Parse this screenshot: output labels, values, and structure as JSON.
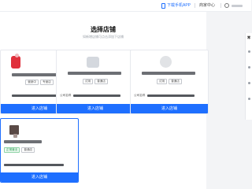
{
  "topbar": {
    "download_label": "下载手机APP",
    "merchant_label": "商家中心",
    "user_prefix": "用"
  },
  "header": {
    "title": "选择店铺",
    "subtitle": "如新增店铺可点击添加下店铺"
  },
  "stores": [
    {
      "tags": [
        "营销中",
        "专营店"
      ],
      "company_label": "",
      "enter_label": "进入店铺",
      "logo_color": "#e0303c"
    },
    {
      "tags": [
        "试用",
        "普通店"
      ],
      "company_label": "公司名称",
      "enter_label": "进入店铺",
      "logo_color": "#cfd3da"
    },
    {
      "tags": [
        "试用",
        "普通店"
      ],
      "company_label": "公司名称",
      "enter_label": "进入店铺",
      "logo_color": "#d9dcdf"
    },
    {
      "tags": [
        "正常营业",
        "普通店"
      ],
      "company_label": "",
      "enter_label": "进入店铺",
      "logo_color": "#5a4a46"
    }
  ],
  "colors": {
    "accent": "#1e6fff",
    "status_green": "#1f9a4c"
  }
}
